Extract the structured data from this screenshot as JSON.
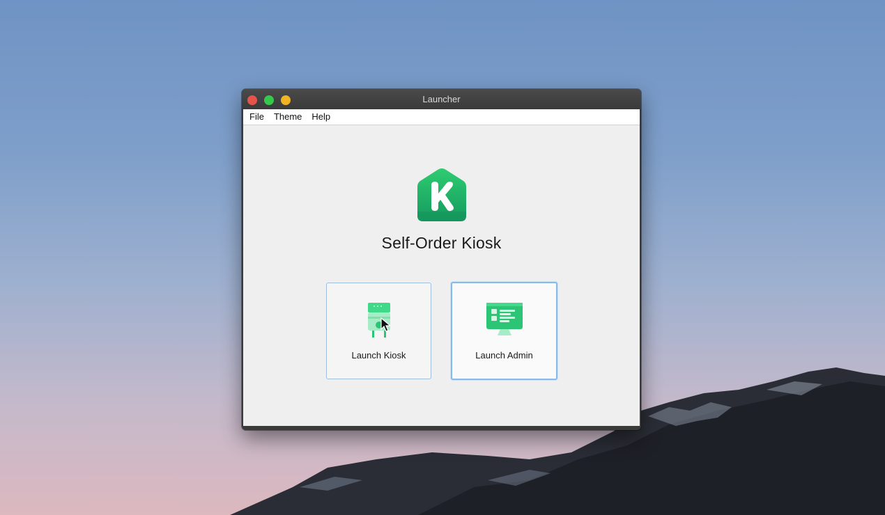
{
  "window": {
    "title": "Launcher"
  },
  "menu": {
    "items": [
      "File",
      "Theme",
      "Help"
    ]
  },
  "app": {
    "name": "Self-Order Kiosk",
    "logo_letter": "K"
  },
  "buttons": {
    "kiosk": {
      "label": "Launch Kiosk",
      "icon": "kiosk-terminal-icon"
    },
    "admin": {
      "label": "Launch Admin",
      "icon": "admin-monitor-icon"
    }
  },
  "colors": {
    "brand_green": "#1fb36a",
    "focus_border": "#8ab9e8",
    "titlebar": "#3a3a3a"
  }
}
